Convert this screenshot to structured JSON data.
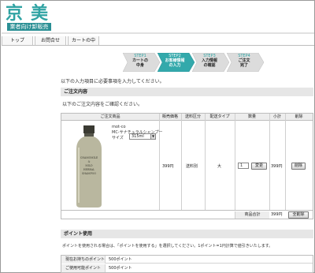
{
  "header": {
    "logo_text": "京美",
    "logo_subtitle": "業者向け卸販売"
  },
  "nav": {
    "items": [
      {
        "label": "トップ"
      },
      {
        "label": "お問合せ"
      },
      {
        "label": "カートの中"
      }
    ]
  },
  "steps": [
    {
      "number": "STEP1",
      "label_line1": "カートの",
      "label_line2": "中身",
      "active": false
    },
    {
      "number": "STEP2",
      "label_line1": "お客様情報",
      "label_line2": "の入力",
      "active": true
    },
    {
      "number": "STEP3",
      "label_line1": "入力情報",
      "label_line2": "の確認",
      "active": false
    },
    {
      "number": "STEP4",
      "label_line1": "ご注文",
      "label_line2": "完了",
      "active": false
    }
  ],
  "intro_text": "以下の入力項目に必要事項を入力してください。",
  "order_section": {
    "heading": "ご注文内容",
    "description": "以下のご注文内容をご確認ください。"
  },
  "cart_table": {
    "headers": [
      "ご注文商品",
      "販売価格",
      "送料区分",
      "配送タイプ",
      "数量",
      "小計",
      "削除"
    ],
    "item": {
      "maker": "mot-co",
      "name": "MC-サナチュラルシャンプー",
      "size_label": "サイズ",
      "size_value": "315ml",
      "price": "399円",
      "shipping_class": "送料別",
      "delivery_type": "大",
      "quantity": "1",
      "change_button": "変更",
      "subtotal": "399円",
      "delete_button": "削除",
      "bottle_label": "CHAMOMILE & MILD HERBAL SHAMPOO"
    },
    "total_label": "商品合計",
    "total_value": "399円",
    "clear_button": "全削除"
  },
  "points_section": {
    "heading": "ポイント使用",
    "description": "ポイントを使用される場合は、「ポイントを使用する」を選択してください。1ポイント=1円計算で値引きいたします。",
    "rows": [
      {
        "label": "現在お持ちのポイント",
        "value": "500ポイント"
      },
      {
        "label": "ご使用可能ポイント",
        "value": "500ポイント"
      }
    ]
  },
  "colors": {
    "brand_teal": "#2fa3a3",
    "step_active": "#33a9ab",
    "step_inactive": "#dcdcdc"
  }
}
